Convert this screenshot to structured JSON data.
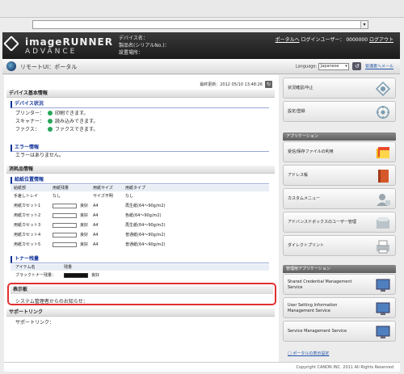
{
  "header": {
    "logo_line1": "imageRUNNER",
    "logo_line2": "ADVANCE",
    "device_name_label": "デバイス名：",
    "product_name_label": "製品名(シリアルNo.)：",
    "location_label": "設置場所：",
    "portal_link": "ポータルへ",
    "login_user_label": "ログインユーザー：",
    "login_user_value": "0000000",
    "logout_link": "ログアウト"
  },
  "portalbar": {
    "title": "リモートUI：ポータル",
    "language_label": "Language:",
    "language_value": "Japanese",
    "admin_mail_link": "管理者へメール"
  },
  "main": {
    "updated": "最終更新：2012 05/10 13:48:26",
    "device_basic_info": "デバイス基本情報",
    "device_status": "デバイス状況",
    "status_rows": [
      {
        "label": "プリンター：",
        "value": "印刷できます。"
      },
      {
        "label": "スキャナー：",
        "value": "読み込みできます。"
      },
      {
        "label": "ファクス：",
        "value": "ファクスできます。"
      }
    ],
    "error_info": "エラー情報",
    "error_text": "エラーはありません。",
    "consumables_info": "消耗品情報",
    "paper_info": "給紙位置情報",
    "paper_headers": [
      "給紙部",
      "用紙残量",
      "用紙サイズ",
      "用紙タイプ"
    ],
    "paper_rows": [
      {
        "source": "手差しトレイ",
        "remaining": "なし",
        "size": "サイズ不明",
        "type": "なし",
        "bar": null
      },
      {
        "source": "用紙カセット1",
        "remaining": "良好",
        "size": "A4",
        "type": "再生紙(64～90g/m2)",
        "bar": 1
      },
      {
        "source": "用紙カセット2",
        "remaining": "良好",
        "size": "A4",
        "type": "色紙(64～90g/m2)",
        "bar": 1
      },
      {
        "source": "用紙カセット3",
        "remaining": "良好",
        "size": "A4",
        "type": "再生紙(64～90g/m2)",
        "bar": 1
      },
      {
        "source": "用紙カセット4",
        "remaining": "良好",
        "size": "A4",
        "type": "普通紙(64～90g/m2)",
        "bar": 1
      },
      {
        "source": "用紙カセット5",
        "remaining": "良好",
        "size": "A4",
        "type": "普通紙(64～90g/m2)",
        "bar": 1
      }
    ],
    "toner_title": "トナー残量",
    "toner_headers": [
      "アイテム名",
      "残量"
    ],
    "toner_row": {
      "name": "ブラックトナー残量：",
      "status": "良好",
      "level": 1
    },
    "notice_title": "表示板",
    "notice_text": "システム管理者からのお知らせ：",
    "support_title": "サポートリンク",
    "support_text": "サポートリンク："
  },
  "side": {
    "tiles_top": [
      {
        "label": "状況確認/中止",
        "icon": "status-monitor-icon"
      },
      {
        "label": "設定/登録",
        "icon": "settings-icon"
      }
    ],
    "apps_title": "アプリケーション",
    "apps": [
      {
        "label": "受信/保存ファイルの利用",
        "icon": "stored-files-icon"
      },
      {
        "label": "アドレス帳",
        "icon": "address-book-icon"
      },
      {
        "label": "カスタムメニュー",
        "icon": "custom-menu-icon"
      },
      {
        "label": "アドバンスドボックスのユーザー管理",
        "icon": "advanced-box-icon"
      },
      {
        "label": "ダイレクトプリント",
        "icon": "direct-print-icon"
      }
    ],
    "admin_title": "管理用アプリケーション",
    "admin_apps": [
      {
        "label1": "Shared Credential Management",
        "label2": "Service"
      },
      {
        "label1": "User Setting Information",
        "label2": "Management Service"
      },
      {
        "label1": "Service Management Service",
        "label2": ""
      }
    ],
    "portal_settings_link": "ポータルの表示設定"
  },
  "footer": {
    "copyright": "Copyright CANON INC. 2011 All Rights Reserved"
  },
  "colors": {
    "header_bg": "#1b1b1b",
    "link": "#2255aa",
    "section_blue": "#113399",
    "status_green": "#28a45a",
    "notice_border": "#e03030"
  }
}
